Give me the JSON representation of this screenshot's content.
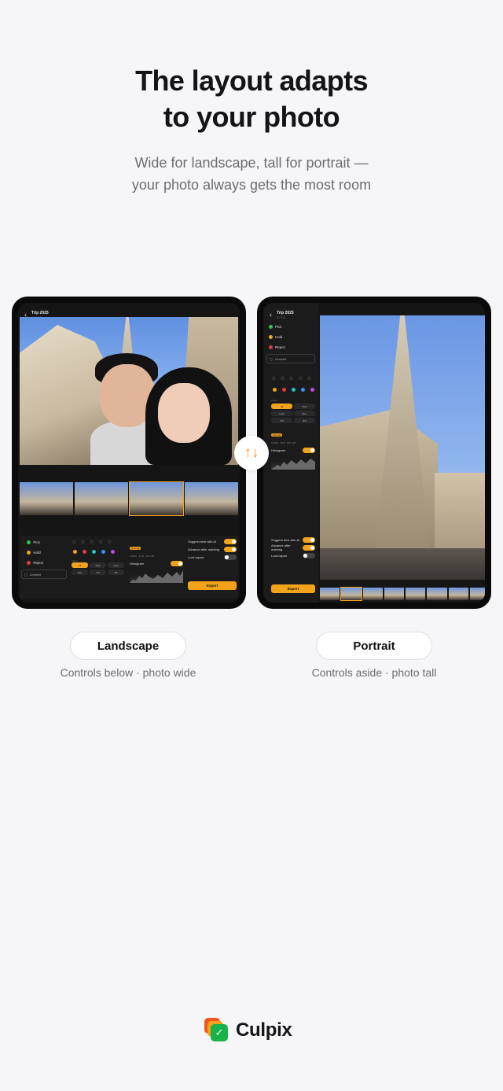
{
  "headline": [
    "The layout adapts",
    "to your photo"
  ],
  "subline": [
    "Wide for landscape, tall for portrait —",
    "your photo always gets the most room"
  ],
  "app": {
    "album_title": "Trip 2025",
    "landscape_count": "14 / 74",
    "portrait_count": "2 / 74",
    "decisions": [
      {
        "label": "Pick",
        "color": "#33c15a"
      },
      {
        "label": "Hold",
        "color": "#f2a21b"
      },
      {
        "label": "Reject",
        "color": "#e23b3b"
      }
    ],
    "dropdown": "Unrated",
    "color_labels": [
      "#f2a21b",
      "#e23b3b",
      "#1fc6b9",
      "#3b8ef2",
      "#b84be3"
    ],
    "filters_label": "Filters",
    "filter_pills": [
      "All",
      "Pick",
      "Hold",
      "★3+",
      "★4",
      "★5"
    ],
    "histogram_tag": "Scoring",
    "histogram_meta": "1/125s · f/1.8 · ISO 125",
    "histogram_label": "Histogram",
    "settings": [
      {
        "label": "Suggest best with AI",
        "on": true
      },
      {
        "label": "Advance after marking",
        "on": true
      },
      {
        "label": "Lock layout",
        "on": false
      }
    ],
    "export_label": "Export"
  },
  "swap_icon": "swap-vertical-arrows",
  "labels": {
    "landscape": "Landscape",
    "landscape_caption": "Controls below · photo wide",
    "portrait": "Portrait",
    "portrait_caption": "Controls aside · photo tall"
  },
  "brand": {
    "name": "Culpix",
    "check": "✓"
  },
  "colors": {
    "accent": "#f2a21b",
    "background": "#f6f6f8"
  }
}
